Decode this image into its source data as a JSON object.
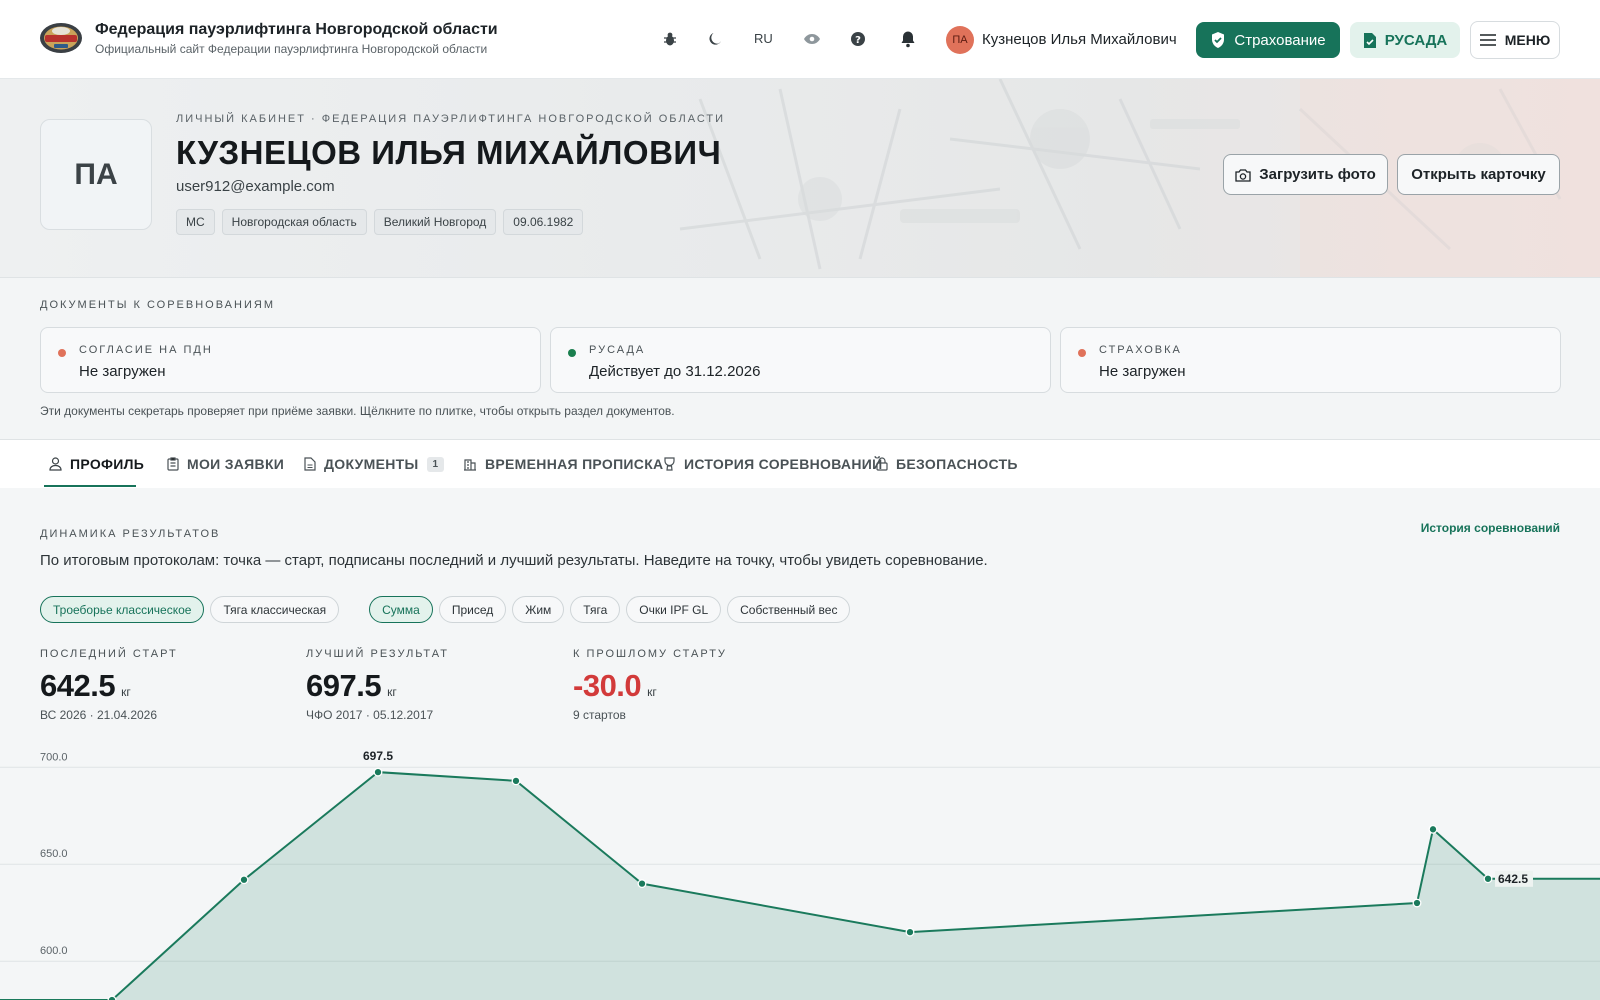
{
  "header": {
    "title": "Федерация пауэрлифтинга Новгородской области",
    "subtitle": "Официальный сайт Федерации пауэрлифтинга Новгородской области",
    "lang": "RU",
    "user_initials": "ПА",
    "user_name": "Кузнецов Илья Михайлович",
    "insurance_label": "Страхование",
    "rusada_label": "РУСАДА",
    "menu_label": "МЕНЮ",
    "icons": [
      "bug-icon",
      "moon-icon",
      "eye-icon",
      "help-icon",
      "bell-icon"
    ]
  },
  "profile": {
    "breadcrumb": "ЛИЧНЫЙ КАБИНЕТ · ФЕДЕРАЦИЯ ПАУЭРЛИФТИНГА НОВГОРОДСКОЙ ОБЛАСТИ",
    "initials": "ПА",
    "name": "КУЗНЕЦОВ ИЛЬЯ МИХАЙЛОВИЧ",
    "email": "user912@example.com",
    "chips": [
      "МС",
      "Новгородская область",
      "Великий Новгород",
      "09.06.1982"
    ],
    "upload_label": "Загрузить фото",
    "card_label": "Открыть карточку"
  },
  "documents": {
    "title": "ДОКУМЕНТЫ К СОРЕВНОВАНИЯМ",
    "items": [
      {
        "label": "СОГЛАСИЕ НА ПДН",
        "status": "Не загружен",
        "color": "#e0725a"
      },
      {
        "label": "РУСАДА",
        "status": "Действует до 31.12.2026",
        "color": "#1a7f4e"
      },
      {
        "label": "СТРАХОВКА",
        "status": "Не загружен",
        "color": "#e0725a"
      }
    ],
    "note": "Эти документы секретарь проверяет при приёме заявки. Щёлкните по плитке, чтобы открыть раздел документов."
  },
  "tabs": [
    {
      "label": "ПРОФИЛЬ",
      "icon": "user-icon",
      "active": true
    },
    {
      "label": "МОИ ЗАЯВКИ",
      "icon": "clipboard-icon"
    },
    {
      "label": "ДОКУМЕНТЫ",
      "icon": "document-icon",
      "badge": "1"
    },
    {
      "label": "ВРЕМЕННАЯ ПРОПИСКА",
      "icon": "building-icon"
    },
    {
      "label": "ИСТОРИЯ СОРЕВНОВАНИЙ",
      "icon": "trophy-icon"
    },
    {
      "label": "БЕЗОПАСНОСТЬ",
      "icon": "lock-icon"
    }
  ],
  "results": {
    "title": "ДИНАМИКА РЕЗУЛЬТАТОВ",
    "history_link": "История соревнований",
    "description": "По итоговым протоколам: точка — старт, подписаны последний и лучший результаты. Наведите на точку, чтобы увидеть соревнование.",
    "discipline_filters": [
      "Троеборье классическое",
      "Тяга классическая"
    ],
    "metric_filters": [
      "Сумма",
      "Присед",
      "Жим",
      "Тяга",
      "Очки IPF GL",
      "Собственный вес"
    ],
    "stats": [
      {
        "label": "ПОСЛЕДНИЙ СТАРТ",
        "value": "642.5",
        "unit": "кг",
        "sub": "ВС 2026 · 21.04.2026"
      },
      {
        "label": "ЛУЧШИЙ РЕЗУЛЬТАТ",
        "value": "697.5",
        "unit": "кг",
        "sub": "ЧФО 2017 · 05.12.2017"
      },
      {
        "label": "К ПРОШЛОМУ СТАРТУ",
        "value": "-30.0",
        "unit": "кг",
        "sub": "9 стартов"
      }
    ]
  },
  "chart_data": {
    "type": "area",
    "title": "",
    "xlabel": "",
    "ylabel": "",
    "ylim": [
      580,
      712
    ],
    "y_ticks": [
      600.0,
      650.0,
      700.0
    ],
    "grid": true,
    "series": [
      {
        "values": [
          580,
          642,
          697.5,
          693,
          640,
          615,
          630,
          668,
          642.5
        ]
      }
    ],
    "point_labels": {
      "2": "697.5",
      "8": "642.5"
    },
    "accent": "#1a7a5c"
  }
}
